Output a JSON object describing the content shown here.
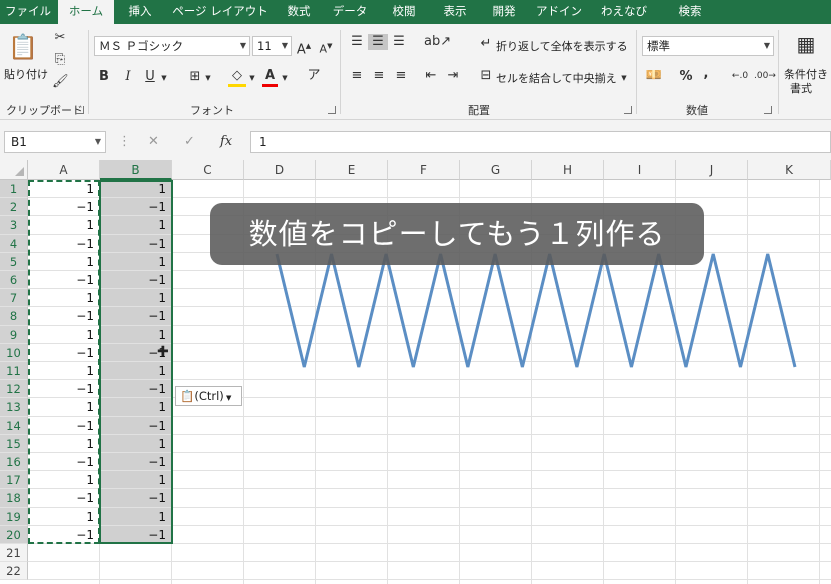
{
  "ribbon_tabs": [
    "ファイル",
    "ホーム",
    "挿入",
    "ページ レイアウト",
    "数式",
    "データ",
    "校閲",
    "表示",
    "開発",
    "アドイン",
    "わえなび",
    "検索"
  ],
  "active_tab": "ホーム",
  "clipboard": {
    "paste_label": "貼り付け",
    "group_label": "クリップボード"
  },
  "font": {
    "name": "ＭＳ Ｐゴシック",
    "size": "11",
    "group_label": "フォント",
    "bold": "B",
    "italic": "I",
    "underline": "U"
  },
  "alignment": {
    "wrap_label": "折り返して全体を表示する",
    "merge_label": "セルを結合して中央揃え",
    "group_label": "配置"
  },
  "number": {
    "format": "標準",
    "percent": "%",
    "comma": ",",
    "group_label": "数値"
  },
  "styles": {
    "conditional_label": "条件付き",
    "conditional_label2": "書式"
  },
  "formula_bar": {
    "name_box": "B1",
    "fx": "fx",
    "value": "1"
  },
  "columns": [
    "A",
    "B",
    "C",
    "D",
    "E",
    "F",
    "G",
    "H",
    "I",
    "J",
    "K"
  ],
  "rows": [
    "1",
    "2",
    "3",
    "4",
    "5",
    "6",
    "7",
    "8",
    "9",
    "10",
    "11",
    "12",
    "13",
    "14",
    "15",
    "16",
    "17",
    "18",
    "19",
    "20",
    "21",
    "22"
  ],
  "colA": [
    "1",
    "−1",
    "1",
    "−1",
    "1",
    "−1",
    "1",
    "−1",
    "1",
    "−1",
    "1",
    "−1",
    "1",
    "−1",
    "1",
    "−1",
    "1",
    "−1",
    "1",
    "−1"
  ],
  "colB": [
    "1",
    "−1",
    "1",
    "−1",
    "1",
    "−1",
    "1",
    "−1",
    "1",
    "−1",
    "1",
    "−1",
    "1",
    "−1",
    "1",
    "−1",
    "1",
    "−1",
    "1",
    "−1"
  ],
  "paste_options": "(Ctrl)",
  "caption": "数値をコピーしてもう１列作る",
  "colors": {
    "excel_green": "#217346",
    "line_blue": "#5b8ec4"
  },
  "chart_data": {
    "type": "line",
    "x": [
      1,
      2,
      3,
      4,
      5,
      6,
      7,
      8,
      9,
      10,
      11,
      12,
      13,
      14,
      15,
      16,
      17,
      18,
      19,
      20
    ],
    "series": [
      {
        "values": [
          1,
          -1,
          1,
          -1,
          1,
          -1,
          1,
          -1,
          1,
          -1,
          1,
          -1,
          1,
          -1,
          1,
          -1,
          1,
          -1,
          1,
          -1
        ]
      }
    ],
    "ylim": [
      -1,
      1
    ]
  }
}
